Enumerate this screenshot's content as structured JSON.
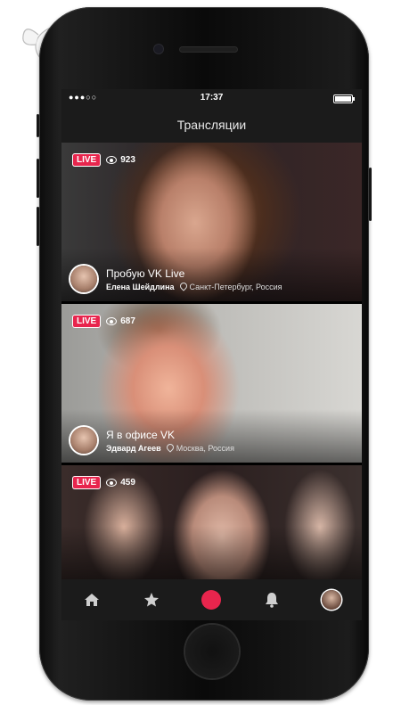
{
  "status_bar": {
    "signal": "●●●○○",
    "time": "17:37"
  },
  "header": {
    "title": "Трансляции"
  },
  "streams": [
    {
      "badge": "LIVE",
      "viewers": "923",
      "title": "Пробую VK Live",
      "author": "Елена Шейдлина",
      "location": "Санкт-Петербург, Россия"
    },
    {
      "badge": "LIVE",
      "viewers": "687",
      "title": "Я в офисе VK",
      "author": "Эдвард Агеев",
      "location": "Москва, Россия"
    },
    {
      "badge": "LIVE",
      "viewers": "459"
    }
  ],
  "tab_bar": {
    "items": [
      {
        "icon": "home-icon"
      },
      {
        "icon": "star-icon"
      },
      {
        "icon": "record-icon"
      },
      {
        "icon": "bell-icon"
      },
      {
        "icon": "profile-avatar"
      }
    ]
  },
  "colors": {
    "accent": "#e8254d",
    "bar": "#1b1b1b"
  }
}
